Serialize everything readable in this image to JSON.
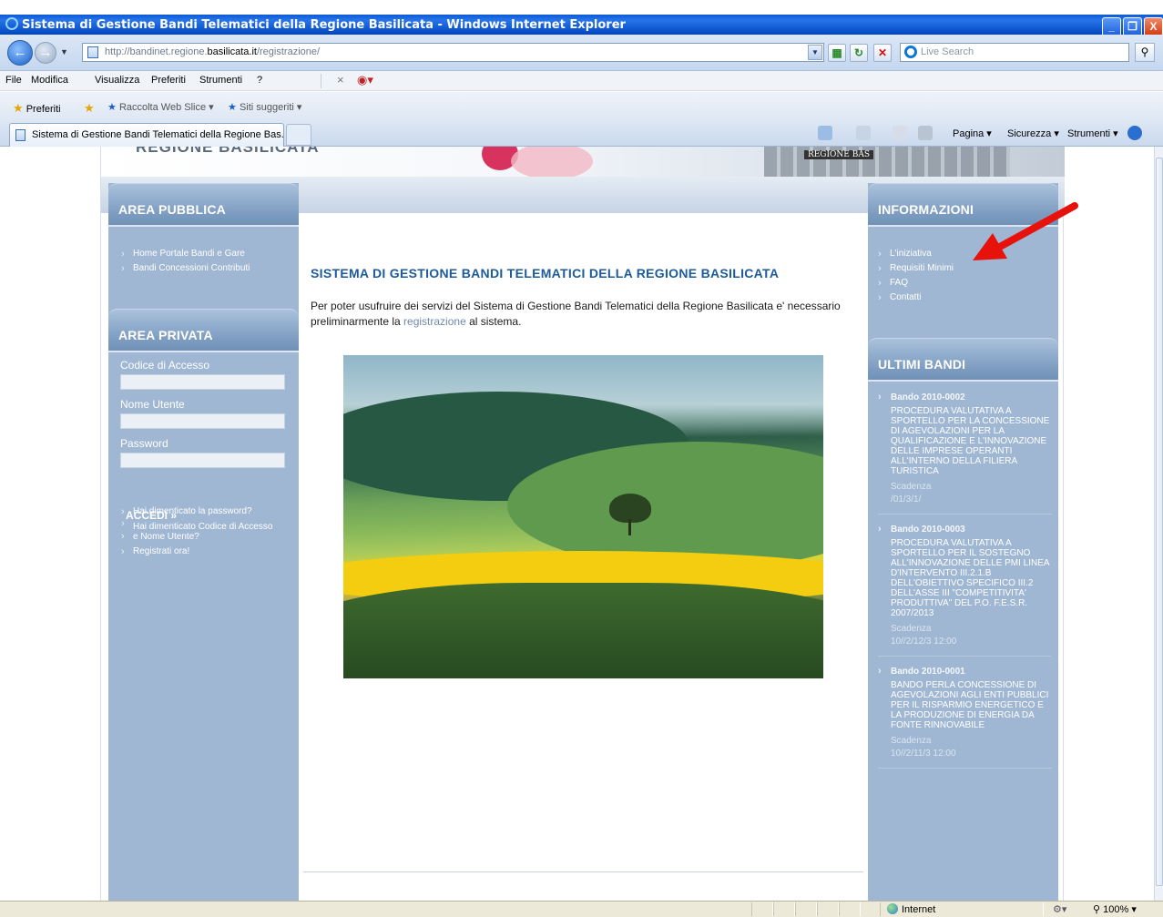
{
  "window": {
    "title": "Sistema di Gestione Bandi Telematici della Regione Basilicata - Windows Internet Explorer",
    "minimize": "_",
    "restore": "❐",
    "close": "X"
  },
  "addressbar": {
    "url_prefix": "http://bandinet.regione.",
    "url_domain": "basilicata.it",
    "url_suffix": "/registrazione/",
    "search_placeholder": "Live Search"
  },
  "menu": {
    "items": [
      "File",
      "Modifica",
      "Visualizza",
      "Preferiti",
      "Strumenti",
      "?"
    ]
  },
  "favorites": {
    "label": "Preferiti",
    "items": [
      "Raccolta Web Slice ▾",
      "Siti suggeriti ▾"
    ]
  },
  "tab": {
    "title": "Sistema di Gestione Bandi Telematici della Regione Bas..."
  },
  "command": {
    "items": [
      "Pagina ▾",
      "Sicurezza ▾",
      "Strumenti ▾"
    ]
  },
  "banner": {
    "header_text": "REGIONE BASILICATA",
    "building_text": "REGIONE BAS"
  },
  "area_pubblica": {
    "title": "AREA PUBBLICA",
    "links": [
      "Home Portale Bandi e Gare",
      "Bandi Concessioni Contributi"
    ]
  },
  "area_privata": {
    "title": "AREA PRIVATA",
    "code_label": "Codice di Accesso",
    "user_label": "Nome Utente",
    "password_label": "Password",
    "login_button": "ACCEDI »",
    "links": [
      "Hai dimenticato la password?",
      "Hai dimenticato Codice di Accesso",
      "e Nome Utente?",
      "Registrati ora!"
    ]
  },
  "main": {
    "title": "SISTEMA DI GESTIONE BANDI TELEMATICI DELLA REGIONE BASILICATA",
    "text_before": "Per poter usufruire dei servizi del Sistema di Gestione Bandi Telematici della Regione Basilicata e' necessario preliminarmente la ",
    "link": "registrazione",
    "text_after": " al sistema."
  },
  "informazioni": {
    "title": "INFORMAZIONI",
    "links": [
      "L'iniziativa",
      "Requisiti Minimi",
      "FAQ",
      "Contatti"
    ]
  },
  "ultimi_bandi": {
    "title": "ULTIMI BANDI",
    "items": [
      {
        "code": "Bando 2010-0002",
        "desc": "PROCEDURA VALUTATIVA A SPORTELLO PER LA CONCESSIONE DI AGEVOLAZIONI PER LA QUALIFICAZIONE E L'INNOVAZIONE DELLE IMPRESE OPERANTI ALL'INTERNO DELLA FILIERA TURISTICA",
        "scadenza_label": "Scadenza",
        "scadenza": "/01/3/1/"
      },
      {
        "code": "Bando 2010-0003",
        "desc": "PROCEDURA VALUTATIVA A SPORTELLO PER IL SOSTEGNO ALL'INNOVAZIONE DELLE PMI LINEA D'INTERVENTO III.2.1.B DELL'OBIETTIVO SPECIFICO III.2 DELL'ASSE III \"COMPETITIVITA' PRODUTTIVA\" DEL P.O. F.E.S.R. 2007/2013",
        "scadenza_label": "Scadenza",
        "scadenza": "10//2/12/3 12:00"
      },
      {
        "code": "Bando 2010-0001",
        "desc": "BANDO PERLA CONCESSIONE DI AGEVOLAZIONI AGLI ENTI PUBBLICI PER IL RISPARMIO ENERGETICO E LA PRODUZIONE DI ENERGIA DA FONTE RINNOVABILE",
        "scadenza_label": "Scadenza",
        "scadenza": "10//2/11/3 12:00"
      }
    ]
  },
  "status": {
    "zone": "Internet",
    "zoom": "100%"
  },
  "colors": {
    "column_bg": "#9fb7d2",
    "title_blue": "#1d5a98",
    "arrow_red": "#e8120c"
  }
}
